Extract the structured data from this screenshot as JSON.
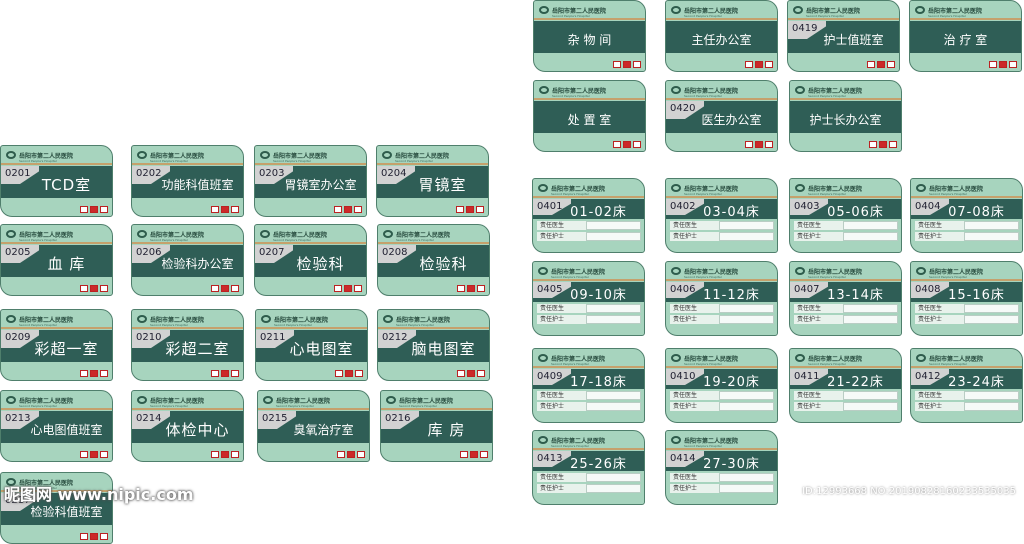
{
  "hospital": {
    "name": "岳阳市第二人民医院",
    "english": "Second People's Hospital"
  },
  "room_signs": [
    {
      "num": "",
      "label": "杂 物 间"
    },
    {
      "num": "",
      "label": "主任办公室"
    },
    {
      "num": "0419",
      "label": "护士值班室"
    },
    {
      "num": "",
      "label": "治 疗 室"
    },
    {
      "num": "",
      "label": "处 置 室"
    },
    {
      "num": "0420",
      "label": "医生办公室"
    },
    {
      "num": "",
      "label": "护士长办公室"
    },
    {
      "num": "0201",
      "label": "TCD室"
    },
    {
      "num": "0202",
      "label": "功能科值班室"
    },
    {
      "num": "0203",
      "label": "胃镜室办公室"
    },
    {
      "num": "0204",
      "label": "胃镜室"
    },
    {
      "num": "0205",
      "label": "血 库"
    },
    {
      "num": "0206",
      "label": "检验科办公室"
    },
    {
      "num": "0207",
      "label": "检验科"
    },
    {
      "num": "0208",
      "label": "检验科"
    },
    {
      "num": "0209",
      "label": "彩超一室"
    },
    {
      "num": "0210",
      "label": "彩超二室"
    },
    {
      "num": "0211",
      "label": "心电图室"
    },
    {
      "num": "0212",
      "label": "脑电图室"
    },
    {
      "num": "0213",
      "label": "心电图值班室"
    },
    {
      "num": "0214",
      "label": "体检中心"
    },
    {
      "num": "0215",
      "label": "臭氧治疗室"
    },
    {
      "num": "0216",
      "label": "库 房"
    },
    {
      "num": "0217",
      "label": "检验科值班室"
    }
  ],
  "bed_signs": [
    {
      "num": "0401",
      "label": "01-02床"
    },
    {
      "num": "0402",
      "label": "03-04床"
    },
    {
      "num": "0403",
      "label": "05-06床"
    },
    {
      "num": "0404",
      "label": "07-08床"
    },
    {
      "num": "0405",
      "label": "09-10床"
    },
    {
      "num": "0406",
      "label": "11-12床"
    },
    {
      "num": "0407",
      "label": "13-14床"
    },
    {
      "num": "0408",
      "label": "15-16床"
    },
    {
      "num": "0409",
      "label": "17-18床"
    },
    {
      "num": "0410",
      "label": "19-20床"
    },
    {
      "num": "0411",
      "label": "21-22床"
    },
    {
      "num": "0412",
      "label": "23-24床"
    },
    {
      "num": "0413",
      "label": "25-26床"
    },
    {
      "num": "0414",
      "label": "27-30床"
    }
  ],
  "bed_fields": {
    "doctor": "责任医生",
    "nurse": "责任护士"
  },
  "watermark": "昵图网 www.nipic.com",
  "image_id": "ID:12993668 NO:20190828160233535035"
}
